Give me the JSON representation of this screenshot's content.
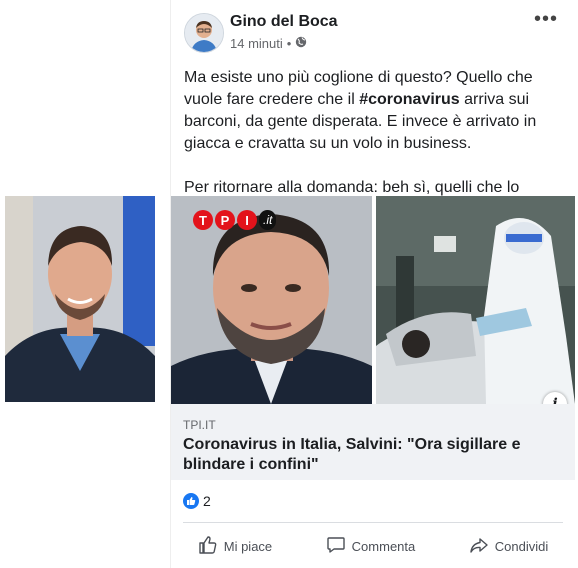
{
  "post": {
    "author": "Gino del Boca",
    "time": "14 minuti",
    "separator": "•",
    "more_label": "•••",
    "text": {
      "line1": "Ma esiste uno più coglione di questo? Quello che vuole fare credere che il ",
      "hashtag": "#coronavirus",
      "line2": " arriva sui barconi, da gente disperata. E invece è arrivato in giacca e cravatta su un volo in business.",
      "para2": "Per ritornare alla domanda: beh sì, quelli che lo votano."
    },
    "link_card": {
      "logo_letters": [
        "T",
        "P",
        "I"
      ],
      "logo_suffix": ".it",
      "domain": "TPI.IT",
      "title": "Coronavirus in Italia, Salvini: \"Ora sigillare e blindare i confini\"",
      "info_label": "i"
    },
    "reactions": {
      "count": "2"
    },
    "actions": {
      "like": "Mi piace",
      "comment": "Commenta",
      "share": "Condividi"
    }
  },
  "colors": {
    "brand_blue": "#1877f2",
    "tpi_red": "#e3131b",
    "caption_bg": "#f0f2f5"
  },
  "icons": [
    "globe-icon",
    "more-options-icon",
    "info-icon",
    "like-reaction-icon",
    "thumbs-up-icon",
    "comment-icon",
    "share-icon"
  ]
}
